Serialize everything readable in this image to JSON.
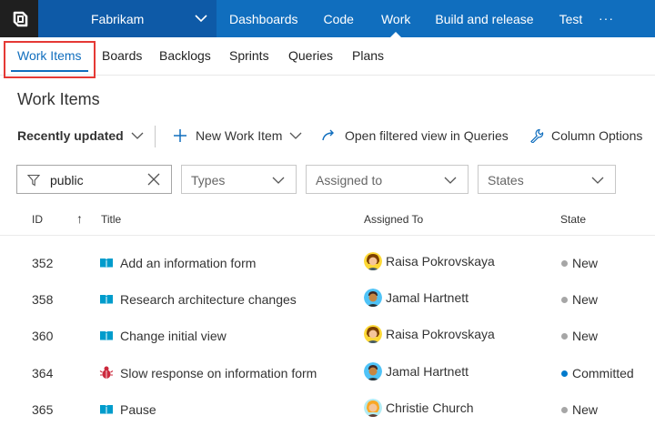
{
  "app": {
    "project_name": "Fabrikam"
  },
  "topnav": {
    "items": [
      "Dashboards",
      "Code",
      "Work",
      "Build and release",
      "Test"
    ],
    "active": "Work",
    "more": "···"
  },
  "subnav": {
    "items": [
      "Work Items",
      "Boards",
      "Backlogs",
      "Sprints",
      "Queries",
      "Plans"
    ],
    "active": "Work Items"
  },
  "page": {
    "title": "Work Items"
  },
  "toolbar": {
    "view_label": "Recently updated",
    "new_item_label": "New Work Item",
    "open_queries_label": "Open filtered view in Queries",
    "column_options_label": "Column Options"
  },
  "filters": {
    "keyword_value": "public",
    "types_placeholder": "Types",
    "assigned_placeholder": "Assigned to",
    "states_placeholder": "States"
  },
  "table": {
    "columns": [
      "ID",
      "Title",
      "Assigned To",
      "State"
    ],
    "sort_indicator": "↑",
    "rows": [
      {
        "id": "352",
        "type": "backlog-item",
        "title": "Add an information form",
        "assigned": "Raisa Pokrovskaya",
        "avatar": "raisa",
        "state": "New",
        "state_color": "#a6a6a6"
      },
      {
        "id": "358",
        "type": "backlog-item",
        "title": "Research architecture changes",
        "assigned": "Jamal Hartnett",
        "avatar": "jamal",
        "state": "New",
        "state_color": "#a6a6a6"
      },
      {
        "id": "360",
        "type": "backlog-item",
        "title": "Change initial view",
        "assigned": "Raisa Pokrovskaya",
        "avatar": "raisa",
        "state": "New",
        "state_color": "#a6a6a6"
      },
      {
        "id": "364",
        "type": "bug",
        "title": "Slow response on information form",
        "assigned": "Jamal Hartnett",
        "avatar": "jamal",
        "state": "Committed",
        "state_color": "#007acc"
      },
      {
        "id": "365",
        "type": "backlog-item",
        "title": "Pause",
        "assigned": "Christie Church",
        "avatar": "christie",
        "state": "New",
        "state_color": "#a6a6a6"
      }
    ]
  },
  "colors": {
    "accent": "#106ebe",
    "project_bg": "#0e5aa7",
    "logo_bg": "#1f1f1f",
    "selection_frame": "#e53935",
    "backlog_icon": "#009ccc",
    "bug_icon": "#cc293d"
  }
}
